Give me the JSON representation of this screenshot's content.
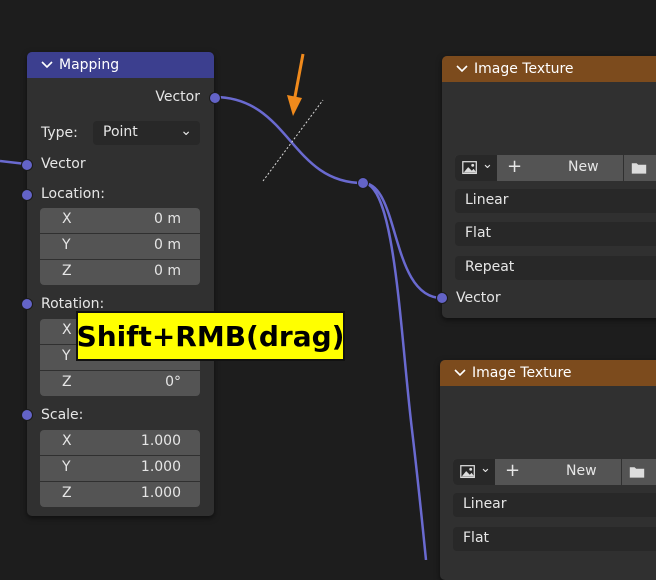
{
  "mapping_node": {
    "title": "Mapping",
    "output_vector": "Vector",
    "type_label": "Type:",
    "type_value": "Point",
    "input_vector": "Vector",
    "location_label": "Location:",
    "location": [
      {
        "axis": "X",
        "value": "0 m"
      },
      {
        "axis": "Y",
        "value": "0 m"
      },
      {
        "axis": "Z",
        "value": "0 m"
      }
    ],
    "rotation_label": "Rotation:",
    "rotation": [
      {
        "axis": "X",
        "value": ""
      },
      {
        "axis": "Y",
        "value": ""
      },
      {
        "axis": "Z",
        "value": "0°"
      }
    ],
    "scale_label": "Scale:",
    "scale": [
      {
        "axis": "X",
        "value": "1.000"
      },
      {
        "axis": "Y",
        "value": "1.000"
      },
      {
        "axis": "Z",
        "value": "1.000"
      }
    ]
  },
  "image_texture_1": {
    "title": "Image Texture",
    "new_label": "New",
    "interpolation": "Linear",
    "projection": "Flat",
    "extension": "Repeat",
    "input_vector": "Vector"
  },
  "image_texture_2": {
    "title": "Image Texture",
    "new_label": "New",
    "interpolation": "Linear",
    "projection": "Flat"
  },
  "overlay": {
    "shortcut": "Shift+RMB(drag)"
  },
  "colors": {
    "background": "#1d1d1d",
    "vector_socket": "#6363c7",
    "mapping_header": "#3c3f8f",
    "texture_header": "#7c4b1d",
    "annotation_arrow": "#f08a1c",
    "tooltip_bg": "#ffff00"
  }
}
